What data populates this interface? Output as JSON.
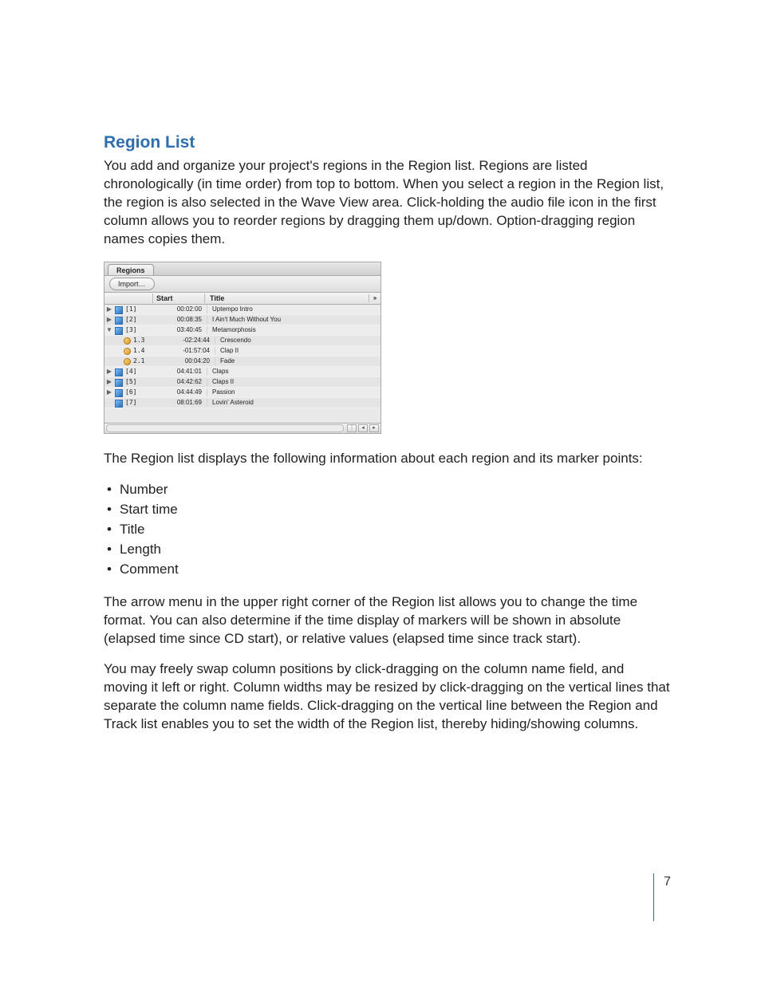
{
  "heading": "Region List",
  "para1": "You add and organize your project's regions in the Region list. Regions are listed chronologically (in time order) from top to bottom. When you select a region in the Region list, the region is also selected in the Wave View area. Click-holding the audio file icon in the first column allows you to reorder regions by dragging them up/down. Option-dragging region names copies them.",
  "para2": "The Region list displays the following information about each region and its marker points:",
  "bullets": [
    "Number",
    "Start time",
    "Title",
    "Length",
    "Comment"
  ],
  "para3": "The arrow menu in the upper right corner of the Region list allows you to change the time format. You can also determine if the time display of markers will be shown in absolute (elapsed time since CD start), or relative values (elapsed time since track start).",
  "para4": "You may freely swap column positions by click-dragging on the column name field, and moving it left or right. Column widths may be resized by click-dragging on the vertical lines that separate the column name fields. Click-dragging on the vertical line between the Region and Track list enables you to set the width of the Region list, thereby hiding/showing columns.",
  "page_number": "7",
  "panel": {
    "tab": "Regions",
    "import_label": "Import…",
    "columns": {
      "start": "Start",
      "title": "Title"
    },
    "arrow": "»",
    "rows": [
      {
        "exp": "▶",
        "iconType": "audio",
        "num": "[1]",
        "start": "00:02:00",
        "title": "Uptempo Intro",
        "indent": false
      },
      {
        "exp": "▶",
        "iconType": "audio",
        "num": "[2]",
        "start": "00:08:35",
        "title": "I Ain't Much Without You",
        "indent": false
      },
      {
        "exp": "▼",
        "iconType": "audio",
        "num": "[3]",
        "start": "03:40:45",
        "title": "Metamorphosis",
        "indent": false
      },
      {
        "exp": "",
        "iconType": "marker",
        "num": "1.3",
        "start": "-02:24:44",
        "title": "Crescendo",
        "indent": true
      },
      {
        "exp": "",
        "iconType": "marker",
        "num": "1.4",
        "start": "-01:57:04",
        "title": "Clap II",
        "indent": true
      },
      {
        "exp": "",
        "iconType": "marker",
        "num": "2.1",
        "start": "00:04:20",
        "title": "Fade",
        "indent": true
      },
      {
        "exp": "▶",
        "iconType": "audio",
        "num": "[4]",
        "start": "04:41:01",
        "title": "Claps",
        "indent": false
      },
      {
        "exp": "▶",
        "iconType": "audio",
        "num": "[5]",
        "start": "04:42:62",
        "title": "Claps II",
        "indent": false
      },
      {
        "exp": "▶",
        "iconType": "audio",
        "num": "[6]",
        "start": "04:44:49",
        "title": "Passion",
        "indent": false
      },
      {
        "exp": "",
        "iconType": "audio",
        "num": "[7]",
        "start": "08:01:69",
        "title": "Lovin' Asteroid",
        "indent": false
      }
    ]
  }
}
